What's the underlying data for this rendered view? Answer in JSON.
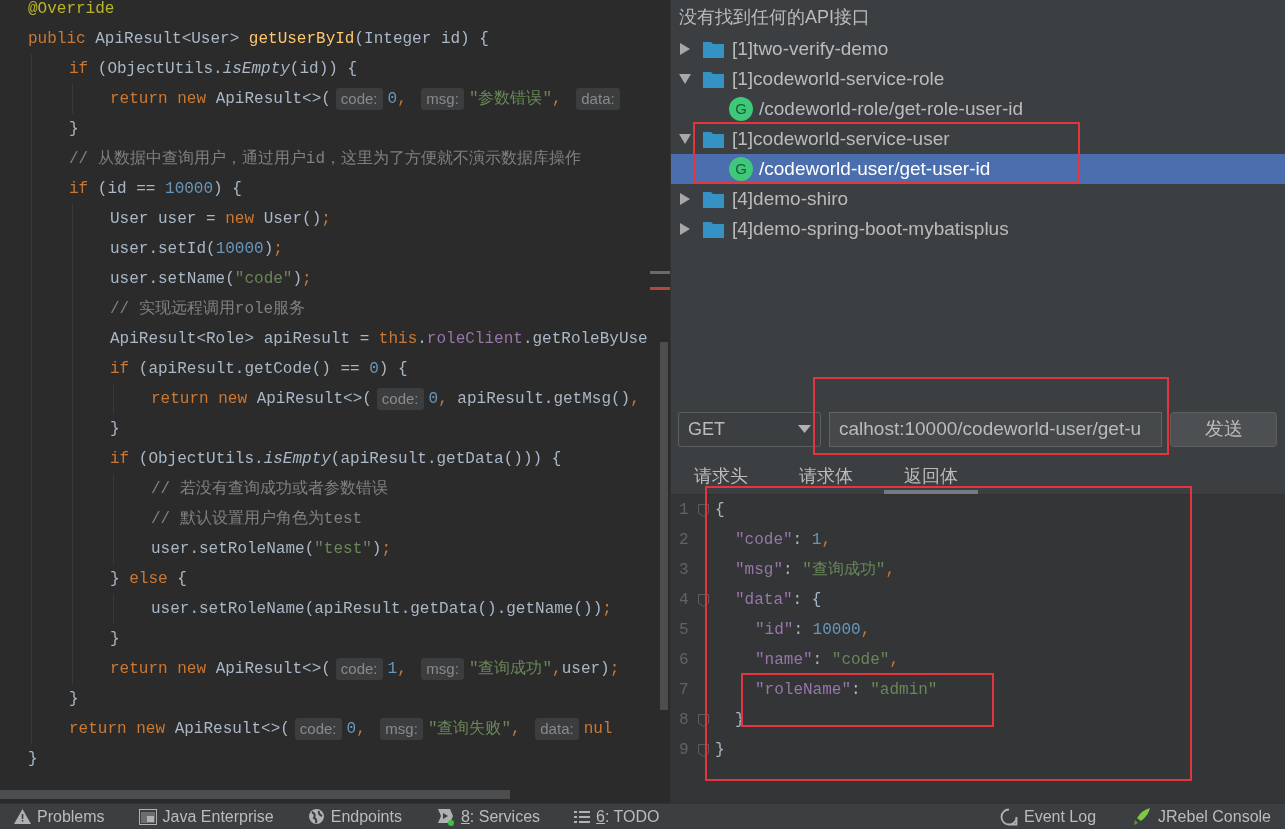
{
  "editor": {
    "lines": [
      {
        "tokens": [
          {
            "kind": "ann",
            "text": "@Override"
          }
        ]
      },
      {
        "tokens": [
          {
            "kind": "kw",
            "text": "public "
          },
          {
            "kind": "plain",
            "text": "ApiResult<User> "
          },
          {
            "kind": "fn",
            "text": "getUserById"
          },
          {
            "kind": "plain",
            "text": "(Integer id) {"
          }
        ],
        "children": [
          {
            "tokens": [
              {
                "kind": "kw",
                "text": "if "
              },
              {
                "kind": "plain",
                "text": "(ObjectUtils."
              },
              {
                "kind": "it",
                "text": "isEmpty"
              },
              {
                "kind": "plain",
                "text": "(id)) {"
              }
            ],
            "children": [
              {
                "tokens": [
                  {
                    "kind": "kw",
                    "text": "return new "
                  },
                  {
                    "kind": "plain",
                    "text": "ApiResult<>("
                  },
                  {
                    "kind": "hint",
                    "text": "code:"
                  },
                  {
                    "kind": "num",
                    "text": "0"
                  },
                  {
                    "kind": "kw",
                    "text": ", "
                  },
                  {
                    "kind": "hint",
                    "text": "msg:"
                  },
                  {
                    "kind": "str",
                    "text": "\"参数错误\""
                  },
                  {
                    "kind": "kw",
                    "text": ", "
                  },
                  {
                    "kind": "hint",
                    "text": "data:"
                  }
                ]
              }
            ]
          },
          {
            "tokens": [
              {
                "kind": "plain",
                "text": "}"
              }
            ]
          },
          {
            "tokens": [
              {
                "kind": "cmt",
                "text": "// 从数据中查询用户，通过用户id，这里为了方便就不演示数据库操作"
              }
            ]
          },
          {
            "tokens": [
              {
                "kind": "kw",
                "text": "if "
              },
              {
                "kind": "plain",
                "text": "(id == "
              },
              {
                "kind": "num",
                "text": "10000"
              },
              {
                "kind": "plain",
                "text": ") {"
              }
            ],
            "children": [
              {
                "tokens": [
                  {
                    "kind": "plain",
                    "text": "User user = "
                  },
                  {
                    "kind": "kw",
                    "text": "new "
                  },
                  {
                    "kind": "plain",
                    "text": "User()"
                  },
                  {
                    "kind": "kw",
                    "text": ";"
                  }
                ]
              },
              {
                "tokens": [
                  {
                    "kind": "plain",
                    "text": "user.setId("
                  },
                  {
                    "kind": "num",
                    "text": "10000"
                  },
                  {
                    "kind": "plain",
                    "text": ")"
                  },
                  {
                    "kind": "kw",
                    "text": ";"
                  }
                ]
              },
              {
                "tokens": [
                  {
                    "kind": "plain",
                    "text": "user.setName("
                  },
                  {
                    "kind": "str",
                    "text": "\"code\""
                  },
                  {
                    "kind": "plain",
                    "text": ")"
                  },
                  {
                    "kind": "kw",
                    "text": ";"
                  }
                ]
              },
              {
                "tokens": [
                  {
                    "kind": "cmt",
                    "text": "// 实现远程调用role服务"
                  }
                ]
              },
              {
                "tokens": [
                  {
                    "kind": "plain",
                    "text": "ApiResult<Role> apiResult = "
                  },
                  {
                    "kind": "kw",
                    "text": "this"
                  },
                  {
                    "kind": "plain",
                    "text": "."
                  },
                  {
                    "kind": "fld",
                    "text": "roleClient"
                  },
                  {
                    "kind": "plain",
                    "text": ".getRoleByUse"
                  }
                ]
              },
              {
                "tokens": [
                  {
                    "kind": "kw",
                    "text": "if "
                  },
                  {
                    "kind": "plain",
                    "text": "(apiResult.getCode() == "
                  },
                  {
                    "kind": "num",
                    "text": "0"
                  },
                  {
                    "kind": "plain",
                    "text": ") {"
                  }
                ],
                "children": [
                  {
                    "tokens": [
                      {
                        "kind": "kw",
                        "text": "return new "
                      },
                      {
                        "kind": "plain",
                        "text": "ApiResult<>("
                      },
                      {
                        "kind": "hint",
                        "text": "code:"
                      },
                      {
                        "kind": "num",
                        "text": "0"
                      },
                      {
                        "kind": "kw",
                        "text": ", "
                      },
                      {
                        "kind": "plain",
                        "text": "apiResult.getMsg()"
                      },
                      {
                        "kind": "kw",
                        "text": ","
                      }
                    ]
                  }
                ]
              },
              {
                "tokens": [
                  {
                    "kind": "plain",
                    "text": "}"
                  }
                ]
              },
              {
                "tokens": [
                  {
                    "kind": "kw",
                    "text": "if "
                  },
                  {
                    "kind": "plain",
                    "text": "(ObjectUtils."
                  },
                  {
                    "kind": "it",
                    "text": "isEmpty"
                  },
                  {
                    "kind": "plain",
                    "text": "(apiResult.getData())) {"
                  }
                ],
                "children": [
                  {
                    "tokens": [
                      {
                        "kind": "cmt",
                        "text": "// 若没有查询成功或者参数错误"
                      }
                    ]
                  },
                  {
                    "tokens": [
                      {
                        "kind": "cmt",
                        "text": "// 默认设置用户角色为test"
                      }
                    ]
                  },
                  {
                    "tokens": [
                      {
                        "kind": "plain",
                        "text": "user.setRoleName("
                      },
                      {
                        "kind": "str",
                        "text": "\"test\""
                      },
                      {
                        "kind": "plain",
                        "text": ")"
                      },
                      {
                        "kind": "kw",
                        "text": ";"
                      }
                    ]
                  }
                ]
              },
              {
                "tokens": [
                  {
                    "kind": "plain",
                    "text": "} "
                  },
                  {
                    "kind": "kw",
                    "text": "else "
                  },
                  {
                    "kind": "plain",
                    "text": "{"
                  }
                ],
                "children": [
                  {
                    "tokens": [
                      {
                        "kind": "plain",
                        "text": "user.setRoleName(apiResult.getData().getName())"
                      },
                      {
                        "kind": "kw",
                        "text": ";"
                      }
                    ]
                  }
                ]
              },
              {
                "tokens": [
                  {
                    "kind": "plain",
                    "text": "}"
                  }
                ]
              },
              {
                "tokens": [
                  {
                    "kind": "kw",
                    "text": "return new "
                  },
                  {
                    "kind": "plain",
                    "text": "ApiResult<>("
                  },
                  {
                    "kind": "hint",
                    "text": "code:"
                  },
                  {
                    "kind": "num",
                    "text": "1"
                  },
                  {
                    "kind": "kw",
                    "text": ", "
                  },
                  {
                    "kind": "hint",
                    "text": "msg:"
                  },
                  {
                    "kind": "str",
                    "text": "\"查询成功\""
                  },
                  {
                    "kind": "kw",
                    "text": ","
                  },
                  {
                    "kind": "plain",
                    "text": "user)"
                  },
                  {
                    "kind": "kw",
                    "text": ";"
                  }
                ]
              }
            ]
          },
          {
            "tokens": [
              {
                "kind": "plain",
                "text": "}"
              }
            ]
          },
          {
            "tokens": [
              {
                "kind": "kw",
                "text": "return new "
              },
              {
                "kind": "plain",
                "text": "ApiResult<>("
              },
              {
                "kind": "hint",
                "text": "code:"
              },
              {
                "kind": "num",
                "text": "0"
              },
              {
                "kind": "kw",
                "text": ", "
              },
              {
                "kind": "hint",
                "text": "msg:"
              },
              {
                "kind": "str",
                "text": "\"查询失败\""
              },
              {
                "kind": "kw",
                "text": ", "
              },
              {
                "kind": "hint",
                "text": "data:"
              },
              {
                "kind": "kw",
                "text": "nul"
              }
            ]
          }
        ]
      },
      {
        "tokens": [
          {
            "kind": "plain",
            "text": "}"
          }
        ]
      }
    ]
  },
  "api_panel": {
    "message": "没有找到任何的API接口",
    "tree": [
      {
        "kind": "module",
        "label": "[1]two-verify-demo",
        "expanded": false,
        "selected": false
      },
      {
        "kind": "module",
        "label": "[1]codeworld-service-role",
        "expanded": true,
        "selected": false,
        "children": [
          {
            "kind": "endpoint",
            "badge": "G",
            "label": "/codeworld-role/get-role-user-id",
            "selected": false
          }
        ]
      },
      {
        "kind": "module",
        "label": "[1]codeworld-service-user",
        "expanded": true,
        "selected": false,
        "children": [
          {
            "kind": "endpoint",
            "badge": "G",
            "label": "/codeworld-user/get-user-id",
            "selected": true
          }
        ]
      },
      {
        "kind": "module",
        "label": "[4]demo-shiro",
        "expanded": false,
        "selected": false
      },
      {
        "kind": "module",
        "label": "[4]demo-spring-boot-mybatisplus",
        "expanded": false,
        "selected": false
      }
    ],
    "request": {
      "method": "GET",
      "url": "calhost:10000/codeworld-user/get-u",
      "send": "发送"
    },
    "tabs": [
      {
        "label": "请求头",
        "selected": false
      },
      {
        "label": "请求体",
        "selected": false
      },
      {
        "label": "返回体",
        "selected": true
      }
    ],
    "response": [
      {
        "number": "1",
        "fold": true,
        "tokens": [
          {
            "kind": "plain",
            "text": "{"
          }
        ],
        "children": [
          {
            "number": "2",
            "fold": false,
            "tokens": [
              {
                "kind": "key",
                "text": "\"code\""
              },
              {
                "kind": "plain",
                "text": ": "
              },
              {
                "kind": "num",
                "text": "1"
              },
              {
                "kind": "kw",
                "text": ","
              }
            ]
          },
          {
            "number": "3",
            "fold": false,
            "tokens": [
              {
                "kind": "key",
                "text": "\"msg\""
              },
              {
                "kind": "plain",
                "text": ": "
              },
              {
                "kind": "str",
                "text": "\"查询成功\""
              },
              {
                "kind": "kw",
                "text": ","
              }
            ]
          },
          {
            "number": "4",
            "fold": true,
            "tokens": [
              {
                "kind": "key",
                "text": "\"data\""
              },
              {
                "kind": "plain",
                "text": ": {"
              }
            ],
            "children": [
              {
                "number": "5",
                "fold": false,
                "tokens": [
                  {
                    "kind": "key",
                    "text": "\"id\""
                  },
                  {
                    "kind": "plain",
                    "text": ": "
                  },
                  {
                    "kind": "num",
                    "text": "10000"
                  },
                  {
                    "kind": "kw",
                    "text": ","
                  }
                ]
              },
              {
                "number": "6",
                "fold": false,
                "tokens": [
                  {
                    "kind": "key",
                    "text": "\"name\""
                  },
                  {
                    "kind": "plain",
                    "text": ": "
                  },
                  {
                    "kind": "str",
                    "text": "\"code\""
                  },
                  {
                    "kind": "kw",
                    "text": ","
                  }
                ]
              },
              {
                "number": "7",
                "fold": false,
                "tokens": [
                  {
                    "kind": "key",
                    "text": "\"roleName\""
                  },
                  {
                    "kind": "plain",
                    "text": ": "
                  },
                  {
                    "kind": "str",
                    "text": "\"admin\""
                  }
                ]
              }
            ]
          },
          {
            "number": "8",
            "fold": true,
            "tokens": [
              {
                "kind": "plain",
                "text": "}"
              }
            ]
          }
        ]
      },
      {
        "number": "9",
        "fold": true,
        "tokens": [
          {
            "kind": "plain",
            "text": "}"
          }
        ]
      }
    ]
  },
  "status_bar": {
    "left": [
      {
        "kind": "problems",
        "label": "Problems"
      },
      {
        "kind": "enterprise",
        "label": "Java Enterprise"
      },
      {
        "kind": "endpoints",
        "label": "Endpoints"
      },
      {
        "kind": "services",
        "key": "8",
        "label": ": Services"
      },
      {
        "kind": "todo",
        "key": "6",
        "label": ": TODO"
      }
    ],
    "right": [
      {
        "kind": "eventlog",
        "label": "Event Log"
      },
      {
        "kind": "jrebel",
        "label": "JRebel Console"
      }
    ]
  }
}
